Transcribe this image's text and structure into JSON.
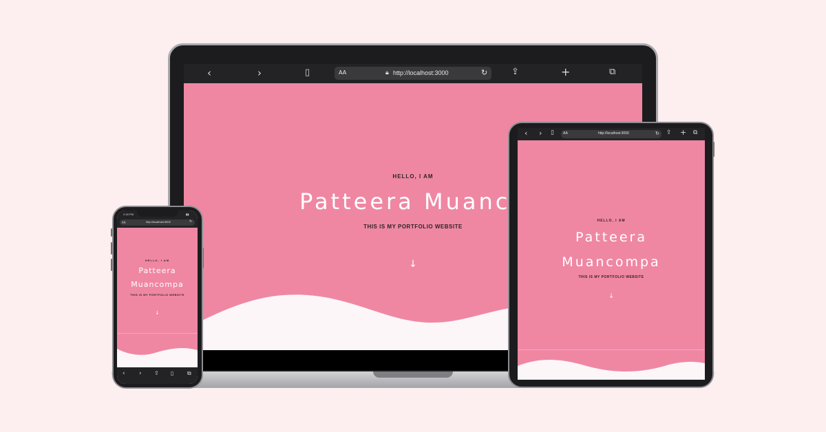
{
  "colors": {
    "background": "#fdeef0",
    "site_pink": "#ef87a3",
    "wave_white": "#fdf6f9",
    "toolbar": "#232325"
  },
  "browser": {
    "reader_label": "AA",
    "url": "http://localhost:3000",
    "icons": [
      "back-icon",
      "forward-icon",
      "bookmarks-icon",
      "lock-icon",
      "reload-icon",
      "share-icon",
      "new-tab-icon",
      "tabs-icon"
    ]
  },
  "hero": {
    "greeting": "HELLO, I AM",
    "name": "Patteera Muancompa",
    "name_line1": "Patteera",
    "name_line2": "Muancompa",
    "laptop_name_visible": "Patteera Muanco",
    "subtitle": "THIS IS MY PORTFOLIO WEBSITE"
  },
  "phone": {
    "status_time": "2:18 PM"
  }
}
